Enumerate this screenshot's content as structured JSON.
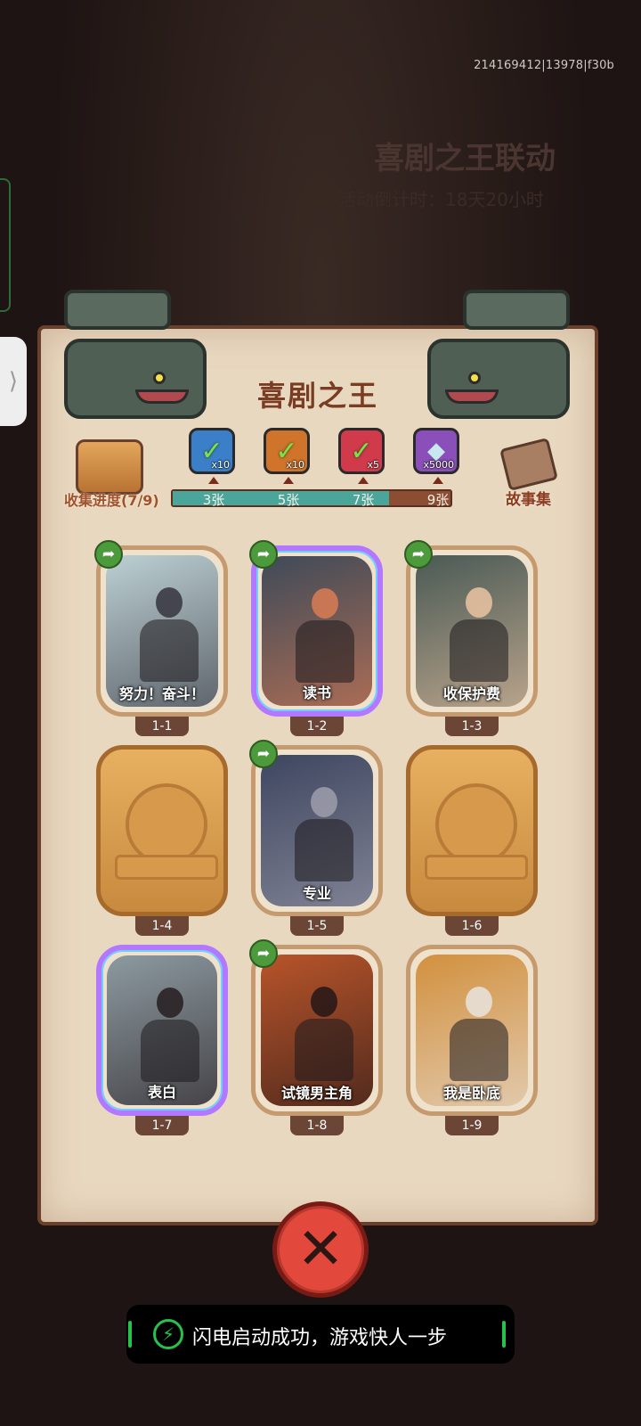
{
  "debug_id": "214169412|13978|f30b",
  "background": {
    "event_title": "喜剧之王联动",
    "countdown": "活动倒计时：18天20小时"
  },
  "panel": {
    "title": "喜剧之王"
  },
  "progress": {
    "collect_label": "收集进度(7/9)",
    "fraction": 0.78,
    "story_label": "故事集",
    "milestones": [
      {
        "label": "3张",
        "qty": "x10",
        "color": "#3b7fc8",
        "claimed": true,
        "icon": "book-reward-icon"
      },
      {
        "label": "5张",
        "qty": "x10",
        "color": "#d0742c",
        "claimed": true,
        "icon": "orange-reward-icon"
      },
      {
        "label": "7张",
        "qty": "x5",
        "color": "#d13a4a",
        "claimed": true,
        "icon": "gem-ball-reward-icon"
      },
      {
        "label": "9张",
        "qty": "x5000",
        "color": "#8a4fb8",
        "claimed": false,
        "icon": "crystal-reward-icon"
      }
    ]
  },
  "cards": [
    {
      "num": "1-1",
      "caption": "努力！奋斗！",
      "state": "unlocked",
      "share": true,
      "bg": "#bcd0d4",
      "fg": "#3b3b44"
    },
    {
      "num": "1-2",
      "caption": "读书",
      "state": "holo",
      "share": true,
      "bg": "#3f4a58",
      "fg": "#d47a54"
    },
    {
      "num": "1-3",
      "caption": "收保护费",
      "state": "unlocked",
      "share": true,
      "bg": "#4a5a55",
      "fg": "#e4c0a0"
    },
    {
      "num": "1-4",
      "caption": "",
      "state": "locked",
      "share": false,
      "bg": "",
      "fg": ""
    },
    {
      "num": "1-5",
      "caption": "专业",
      "state": "unlocked",
      "share": true,
      "bg": "#3e4660",
      "fg": "#9a9aa8"
    },
    {
      "num": "1-6",
      "caption": "",
      "state": "locked",
      "share": false,
      "bg": "",
      "fg": ""
    },
    {
      "num": "1-7",
      "caption": "表白",
      "state": "holo",
      "share": false,
      "bg": "#8c9aa0",
      "fg": "#2a2226"
    },
    {
      "num": "1-8",
      "caption": "试镜男主角",
      "state": "unlocked",
      "share": true,
      "bg": "#b8542a",
      "fg": "#2a1a18"
    },
    {
      "num": "1-9",
      "caption": "我是卧底",
      "state": "unlocked",
      "share": false,
      "bg": "#d2903e",
      "fg": "#e8e0d8"
    }
  ],
  "toast": {
    "text": "闪电启动成功，游戏快人一步"
  }
}
